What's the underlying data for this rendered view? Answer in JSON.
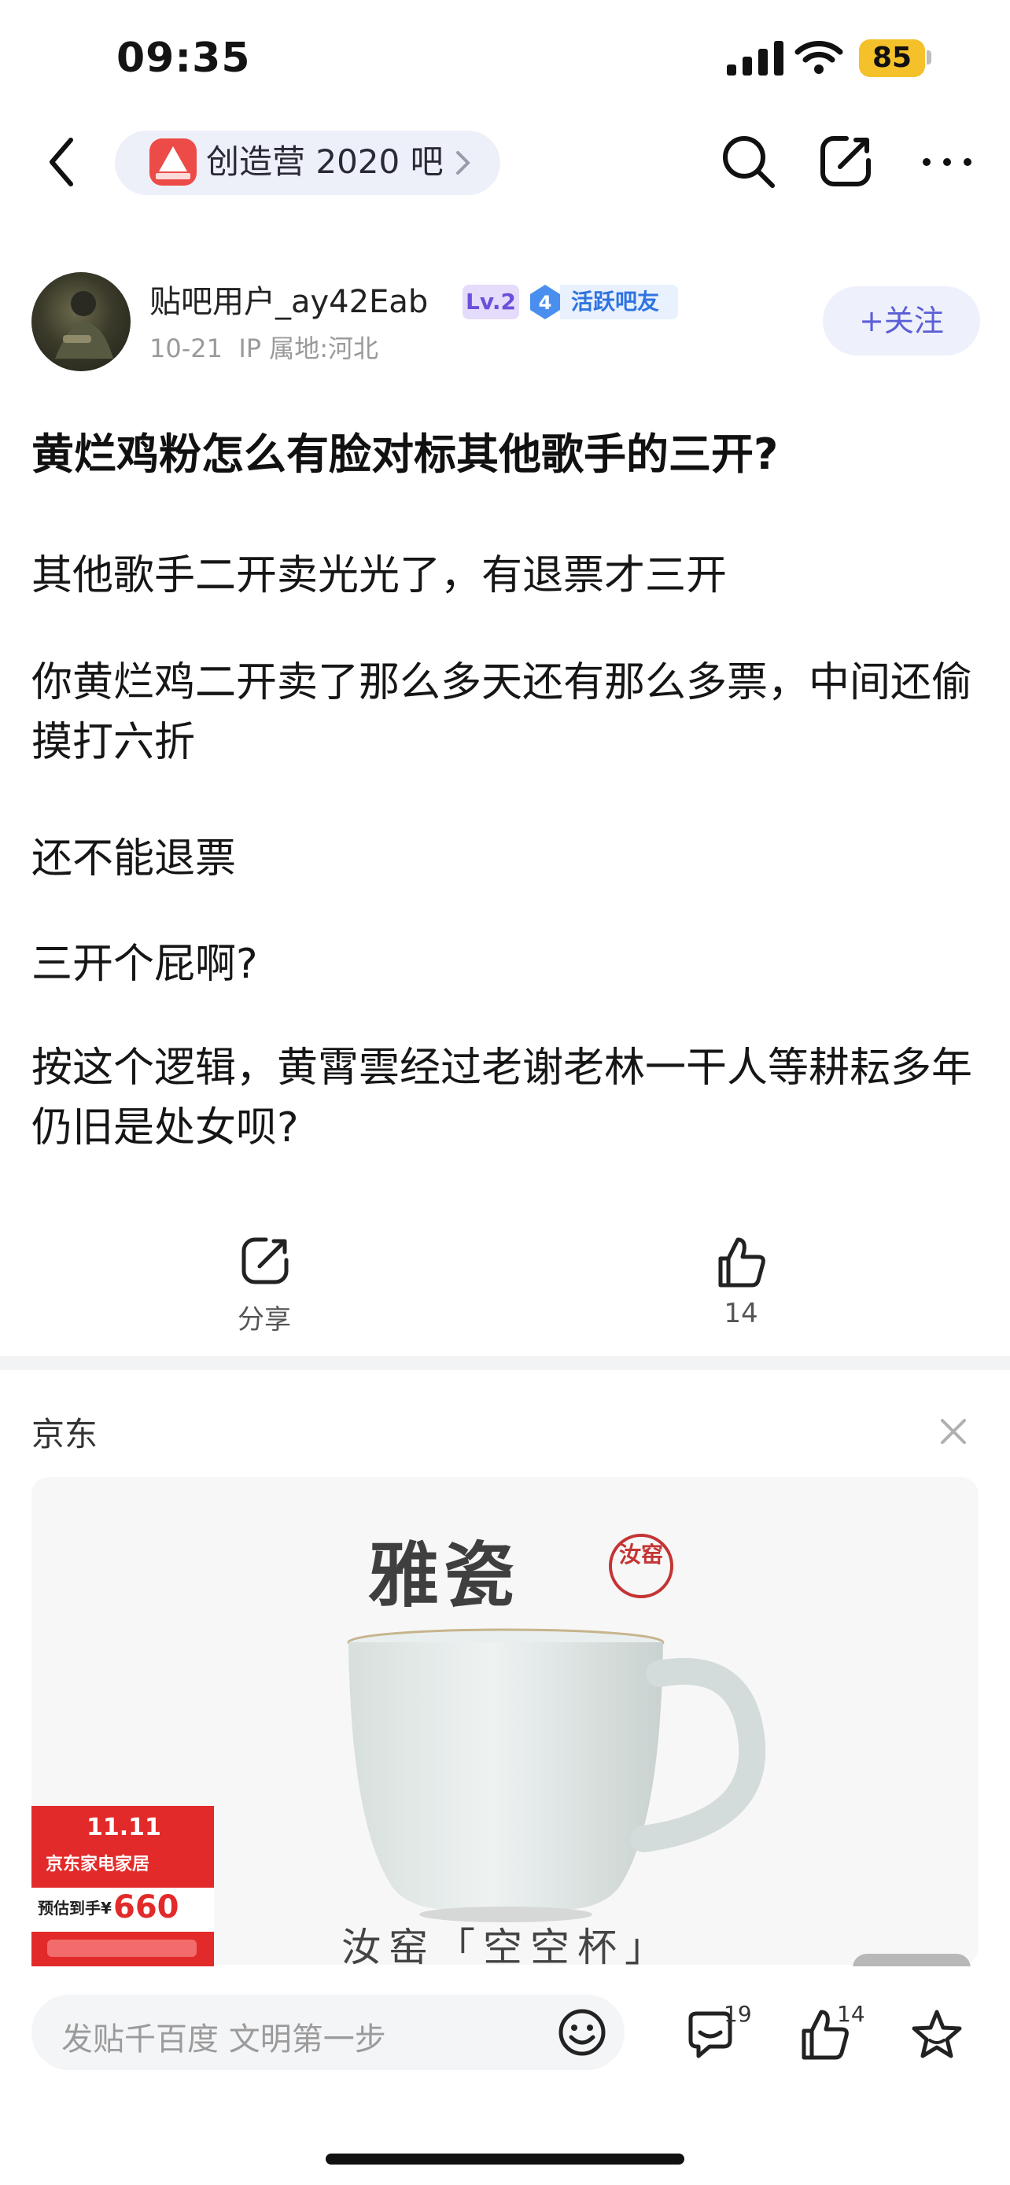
{
  "status_bar": {
    "time": "09:35",
    "battery": "85"
  },
  "nav": {
    "forum_name": "创造营 2020 吧",
    "icons": [
      "back-icon",
      "search-icon",
      "edit-icon",
      "more-icon"
    ]
  },
  "author": {
    "name": "贴吧用户_ay42Eab",
    "level": "Lv.2",
    "active_level": "4",
    "active_label": "活跃吧友",
    "date": "10-21",
    "ip": "IP 属地:河北",
    "follow_label": "+关注"
  },
  "post": {
    "title": "黄烂鸡粉怎么有脸对标其他歌手的三开?",
    "paragraphs": [
      "其他歌手二开卖光光了，有退票才三开",
      "你黄烂鸡二开卖了那么多天还有那么多票，中间还偷摸打六折",
      "还不能退票",
      "三开个屁啊?",
      "按这个逻辑，黄霄雲经过老谢老林一干人等耕耘多年仍旧是处女呗?"
    ]
  },
  "actions": {
    "share_label": "分享",
    "like_count": "14"
  },
  "ad": {
    "source": "京东",
    "brand": "雅瓷",
    "seal": "汝窑",
    "caption": "汝窑「空空杯」",
    "promo": {
      "line1": "11.11",
      "line2": "京东家电家居",
      "line3": "预估到手¥",
      "price": "660"
    }
  },
  "bottom_bar": {
    "placeholder": "发贴千百度 文明第一步",
    "comment_count": "19",
    "like_count": "14"
  },
  "colors": {
    "accent": "#5b5fd6",
    "level_bg": "#e4dcfa",
    "battery": "#f4c12a"
  }
}
